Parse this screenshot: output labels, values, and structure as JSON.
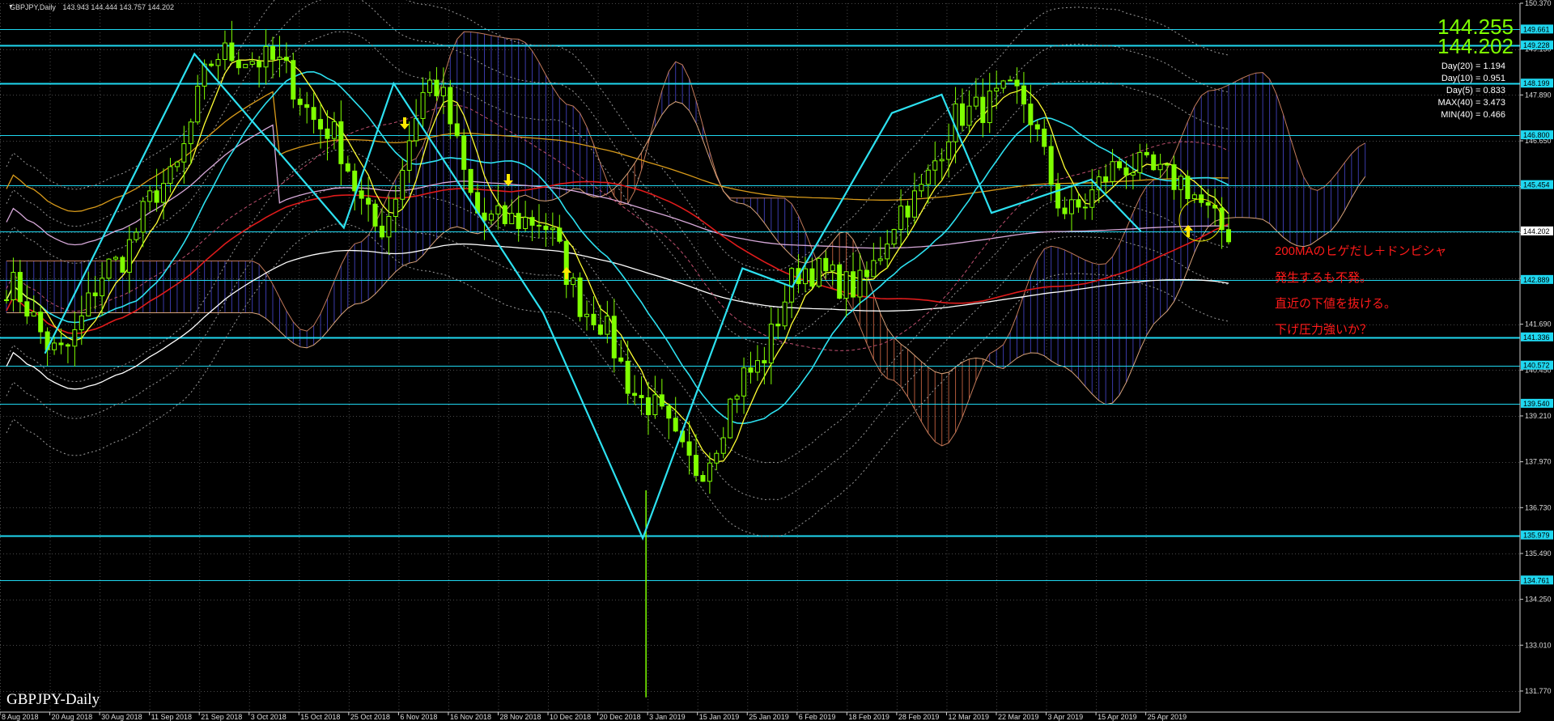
{
  "window": {
    "symbol": "GBPJPY,Daily",
    "ohlc": "143.943 144.444 143.757 144.202",
    "watermark": "GBPJPY-Daily"
  },
  "info_panel": {
    "price_bid": "144.255",
    "price_ask": "144.202",
    "lines": [
      "Day(20) = 1.194",
      "Day(10) = 0.951",
      "Day(5) = 0.833",
      "MAX(40) = 3.473",
      "MIN(40) = 0.466"
    ],
    "colors": {
      "bid": "#7fff00",
      "ask": "#7fff00",
      "lines": "#ffffff"
    }
  },
  "annotation": {
    "lines": [
      "200MAのヒゲだし＋ドンピシャ",
      "発生するも不発。",
      "直近の下値を抜ける。",
      "下げ圧力強いか？"
    ],
    "color": "#ff1a1a"
  },
  "colors": {
    "background": "#000000",
    "grid": "#4a4a4a",
    "candle": "#7fff00",
    "hline": "#1fd7f0",
    "ma_fast": "#ffff33",
    "ma_mid": "#2de1f0",
    "ma_red": "#e01b1b",
    "ma_orange": "#d99b1a",
    "ma_pink": "#d7a9d9",
    "ma_white": "#ffffff",
    "kumo_bull": "#3a3aa8",
    "kumo_bear": "#b0583a",
    "zigzag": "#2de1f0",
    "arrow": "#ffe900"
  },
  "chart_data": {
    "type": "line",
    "symbol": "GBPJPY",
    "timeframe": "Daily",
    "y_range": [
      131.2,
      150.37
    ],
    "x_labels": [
      "8 Aug 2018",
      "20 Aug 2018",
      "30 Aug 2018",
      "11 Sep 2018",
      "21 Sep 2018",
      "3 Oct 2018",
      "15 Oct 2018",
      "25 Oct 2018",
      "6 Nov 2018",
      "16 Nov 2018",
      "28 Nov 2018",
      "10 Dec 2018",
      "20 Dec 2018",
      "3 Jan 2019",
      "15 Jan 2019",
      "25 Jan 2019",
      "6 Feb 2019",
      "18 Feb 2019",
      "28 Feb 2019",
      "12 Mar 2019",
      "22 Mar 2019",
      "3 Apr 2019",
      "15 Apr 2019",
      "25 Apr 2019"
    ],
    "y_ticks": [
      "150.370",
      "149.130",
      "147.890",
      "146.650",
      "145.410",
      "144.170",
      "142.930",
      "141.690",
      "140.450",
      "139.210",
      "137.970",
      "136.730",
      "135.490",
      "134.250",
      "133.010",
      "131.770"
    ],
    "price_levels": [
      "149.661",
      "149.228",
      "148.199",
      "146.800",
      "145.454",
      "144.202",
      "142.889",
      "141.336",
      "140.572",
      "139.540",
      "135.979",
      "134.761"
    ],
    "series": [
      {
        "name": "GBPJPY",
        "x": [
          "8 Aug 2018",
          "20 Aug 2018",
          "30 Aug 2018",
          "11 Sep 2018",
          "21 Sep 2018",
          "3 Oct 2018",
          "15 Oct 2018",
          "25 Oct 2018",
          "6 Nov 2018",
          "16 Nov 2018",
          "28 Nov 2018",
          "10 Dec 2018",
          "20 Dec 2018",
          "3 Jan 2019",
          "15 Jan 2019",
          "25 Jan 2019",
          "6 Feb 2019",
          "18 Feb 2019",
          "28 Feb 2019",
          "12 Mar 2019",
          "22 Mar 2019",
          "3 Apr 2019",
          "15 Apr 2019",
          "25 Apr 2019"
        ],
        "values": [
          142.8,
          140.9,
          143.3,
          145.5,
          149.0,
          148.8,
          147.0,
          144.3,
          148.2,
          144.5,
          144.5,
          142.0,
          139.6,
          137.8,
          140.4,
          143.2,
          142.7,
          145.0,
          147.4,
          147.9,
          144.7,
          146.0,
          145.6,
          144.2
        ]
      }
    ]
  }
}
